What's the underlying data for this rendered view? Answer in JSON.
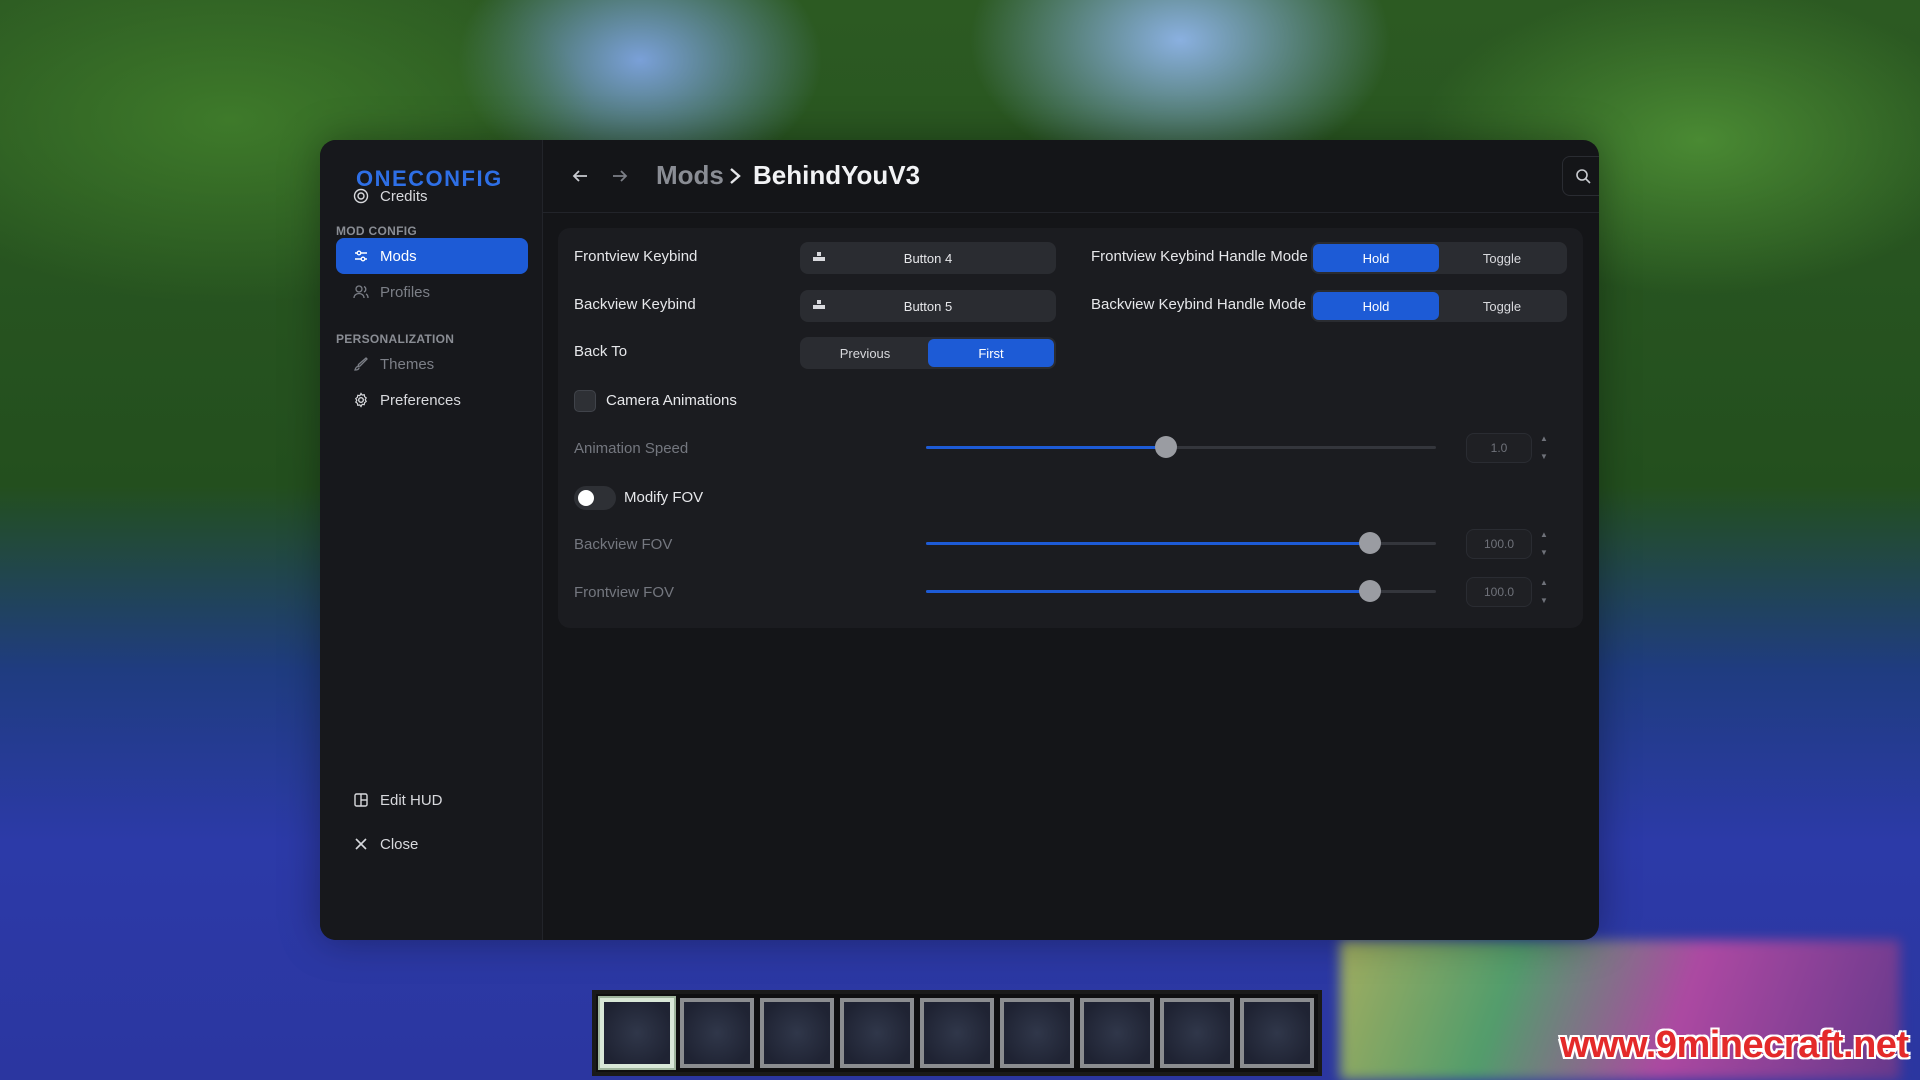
{
  "app": {
    "logo": "ONECONFIG"
  },
  "sidebar": {
    "credits": "Credits",
    "section_mod_config": "MOD CONFIG",
    "mods": "Mods",
    "profiles": "Profiles",
    "section_personalization": "PERSONALIZATION",
    "themes": "Themes",
    "preferences": "Preferences",
    "edit_hud": "Edit HUD",
    "close": "Close"
  },
  "header": {
    "breadcrumb_parent": "Mods",
    "breadcrumb_current": "BehindYouV3",
    "search_placeholder": "Search..."
  },
  "settings": {
    "frontview_keybind": {
      "label": "Frontview Keybind",
      "value": "Button 4"
    },
    "backview_keybind": {
      "label": "Backview Keybind",
      "value": "Button 5"
    },
    "frontview_mode": {
      "label": "Frontview Keybind Handle Mode",
      "options": [
        "Hold",
        "Toggle"
      ],
      "selected": "Hold"
    },
    "backview_mode": {
      "label": "Backview Keybind Handle Mode",
      "options": [
        "Hold",
        "Toggle"
      ],
      "selected": "Hold"
    },
    "back_to": {
      "label": "Back To",
      "options": [
        "Previous",
        "First"
      ],
      "selected": "First"
    },
    "camera_animations": {
      "label": "Camera Animations",
      "checked": false
    },
    "animation_speed": {
      "label": "Animation Speed",
      "value": "1.0",
      "fraction": 0.47
    },
    "modify_fov": {
      "label": "Modify FOV",
      "enabled": false
    },
    "backview_fov": {
      "label": "Backview FOV",
      "value": "100.0",
      "fraction": 0.87
    },
    "frontview_fov": {
      "label": "Frontview FOV",
      "value": "100.0",
      "fraction": 0.87
    }
  },
  "hotbar": {
    "slots": 9,
    "selected": 1
  },
  "watermark": "www.9minecraft.net",
  "colors": {
    "accent": "#1d5bd6",
    "window_bg": "#141518",
    "panel_bg": "#1b1c20"
  }
}
